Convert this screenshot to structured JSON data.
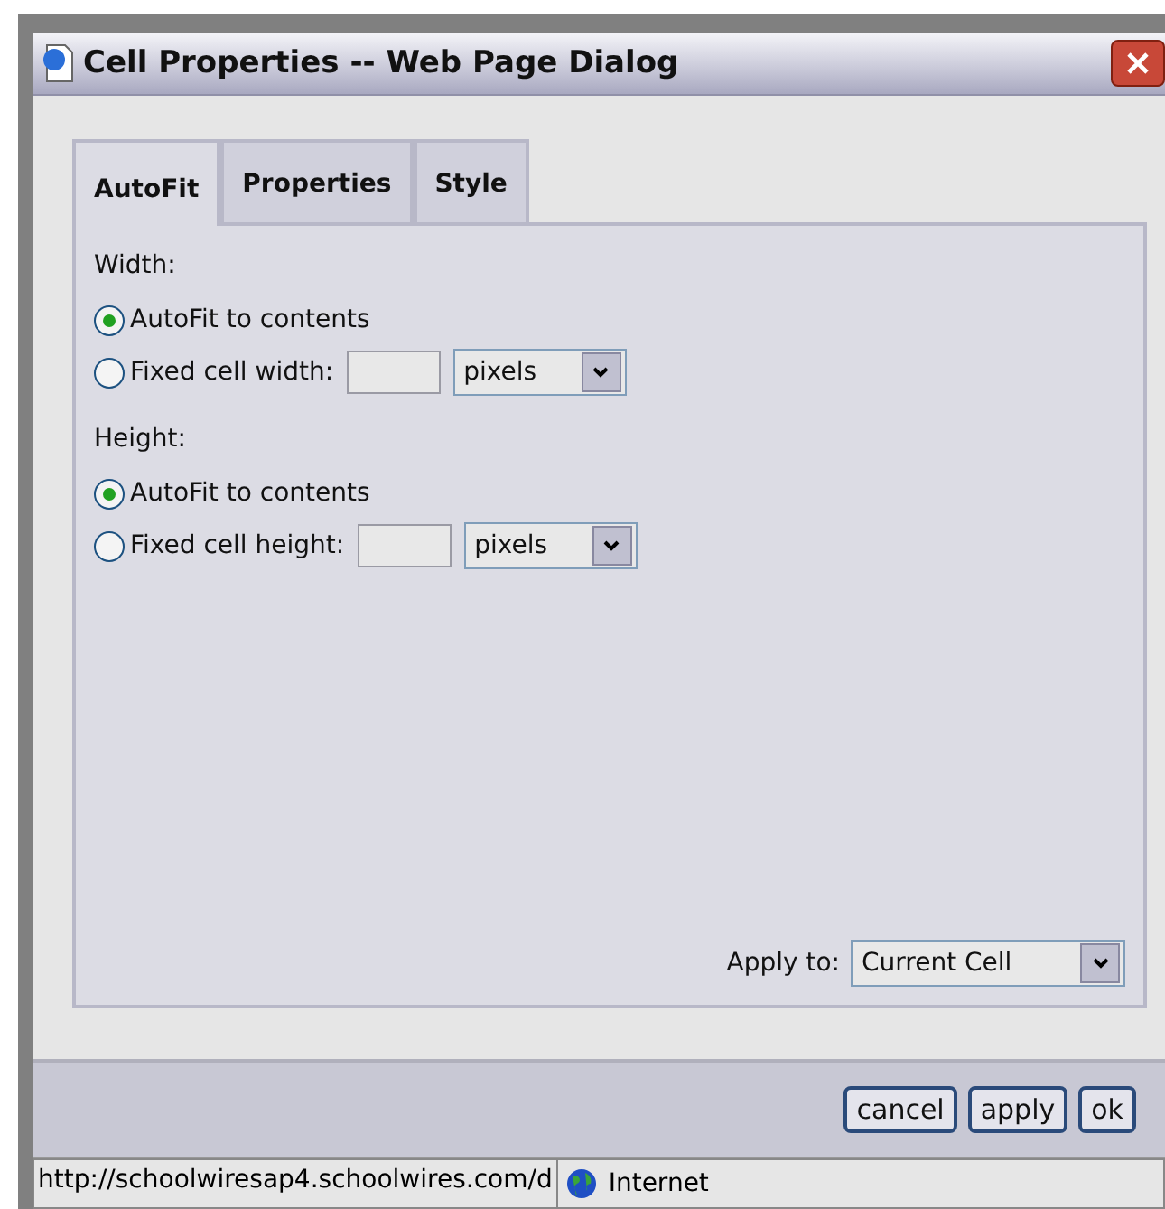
{
  "window": {
    "title": "Cell Properties -- Web Page Dialog"
  },
  "tabs": [
    {
      "label": "AutoFit",
      "selected": true
    },
    {
      "label": "Properties",
      "selected": false
    },
    {
      "label": "Style",
      "selected": false
    }
  ],
  "sections": [
    {
      "label": "Width:",
      "options": [
        {
          "kind": "plain",
          "label": "AutoFit to contents",
          "selected": true
        },
        {
          "kind": "fixed",
          "label": "Fixed cell width:",
          "selected": false,
          "unit": "pixels"
        }
      ]
    },
    {
      "label": "Height:",
      "options": [
        {
          "kind": "plain",
          "label": "AutoFit to contents",
          "selected": true
        },
        {
          "kind": "fixed",
          "label": "Fixed cell height:",
          "selected": false,
          "unit": "pixels"
        }
      ]
    }
  ],
  "apply_to": {
    "label": "Apply to:",
    "value": "Current Cell"
  },
  "buttons": [
    "cancel",
    "apply",
    "ok"
  ],
  "status_bar": {
    "url": "http://schoolwiresap4.schoolwires.com/d",
    "zone": "Internet"
  }
}
